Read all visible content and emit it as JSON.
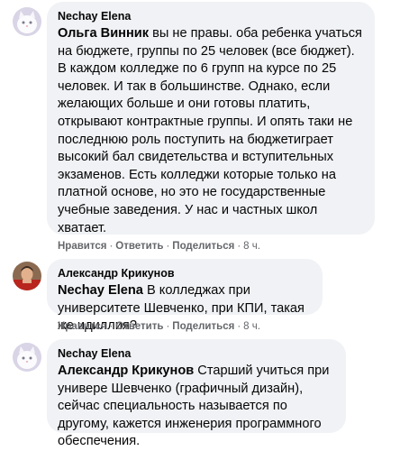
{
  "comments": [
    {
      "author": "Nechay Elena",
      "avatar_icon": "white-cat-avatar-icon",
      "mention": "Ольга Винник",
      "text": " вы не правы. оба ребенка учаться на бюджете, группы по 25 человек (все бюджет). В каждом колледже по 6 групп на курсе по 25 человек. И так в большинстве. Однако, если желающих больше и они готовы платить, открывают контрактные группы. И опять таки не последнюю роль поступить на бюджетиграет высокий бал свидетельства и вступительных экзаменов. Есть колледжи которые только на платной основе, но это не государственные учебные заведения. У нас и частных школ хватает.",
      "like_label": "Нравится",
      "reply_label": "Ответить",
      "share_label": "Поделиться",
      "time": "8 ч."
    },
    {
      "author": "Александр Крикунов",
      "avatar_icon": "man-photo-avatar-icon",
      "mention": "Nechay Elena",
      "text": " В колледжах при университете Шевченко, при КПИ, такая же идиллия?",
      "like_label": "Нравится",
      "reply_label": "Ответить",
      "share_label": "Поделиться",
      "time": "8 ч."
    },
    {
      "author": "Nechay Elena",
      "avatar_icon": "white-cat-avatar-icon",
      "mention": "Александр Крикунов",
      "text": " Старший учиться при универе Шевченко (графичный дизайн), сейчас специальность называется по другому, кажется инженерия программного обеспечения.",
      "like_label": "",
      "reply_label": "",
      "share_label": "",
      "time": ""
    }
  ],
  "separator": "·",
  "colors": {
    "bubble_bg": "#f0f2f5",
    "meta_text": "#65676b",
    "text": "#050505"
  }
}
